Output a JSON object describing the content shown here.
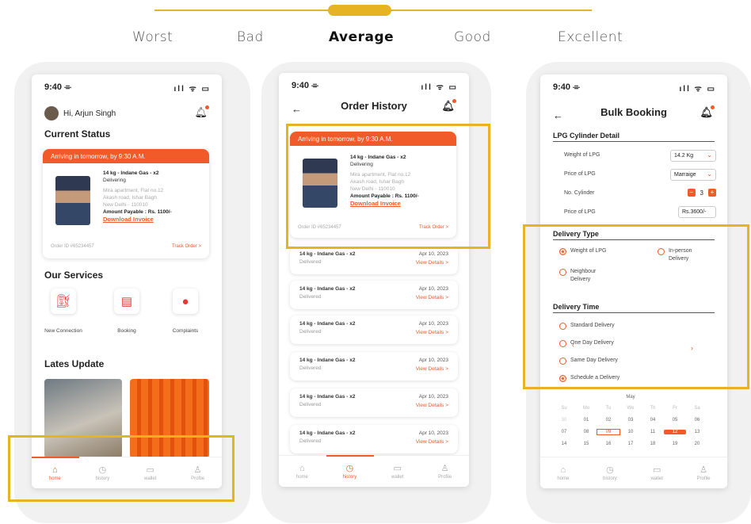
{
  "scale": {
    "labels": [
      "Worst",
      "Bad",
      "Average",
      "Good",
      "Excellent"
    ],
    "selected": "Average"
  },
  "status_bar": {
    "time": "9:40 ⌯",
    "icons": "ıll ᯤ ▭"
  },
  "phone_home": {
    "greeting": "Hi, Arjun Singh",
    "current_status": "Current Status",
    "order": {
      "banner": "Arriving in tomorrow, by 9:30 A.M.",
      "item": "14 kg - Indane Gas - x2",
      "status": "Delivering",
      "address": [
        "Mira apartment, Flat no.12",
        "Akash road, Ishar Bagh",
        "New Delhi - 110010"
      ],
      "amount": "Amount Payable : Rs. 1100/-",
      "invoice": "Download Invoice",
      "order_id": "Order ID #65234457",
      "track": "Track Order >"
    },
    "our_services": "Our Services",
    "services": [
      "New Connection",
      "Booking",
      "Complaints"
    ],
    "latest_update": "Lates Update"
  },
  "phone_history": {
    "title": "Order History",
    "items": [
      {
        "name": "14 kg - Indane Gas - x2",
        "status": "Delivered",
        "date": "Apr 10, 2023",
        "link": "View Details >"
      },
      {
        "name": "14 kg - Indane Gas - x2",
        "status": "Delivered",
        "date": "Apr 10, 2023",
        "link": "View Details >"
      },
      {
        "name": "14 kg - Indane Gas - x2",
        "status": "Delivered",
        "date": "Apr 10, 2023",
        "link": "View Details >"
      },
      {
        "name": "14 kg - Indane Gas - x2",
        "status": "Delivered",
        "date": "Apr 10, 2023",
        "link": "View Details >"
      },
      {
        "name": "14 kg - Indane Gas - x2",
        "status": "Delivered",
        "date": "Apr 10, 2023",
        "link": "View Details >"
      },
      {
        "name": "14 kg - Indane Gas - x2",
        "status": "Delivered",
        "date": "Apr 10, 2023",
        "link": "View Details >"
      }
    ]
  },
  "phone_booking": {
    "title": "Bulk Booking",
    "cylinder_section": "LPG Cylinder Detail",
    "weight_label": "Weight of LPG",
    "weight_value": "14.2 Kg",
    "price_label": "Price of LPG",
    "price_value": "Marraige",
    "count_label": "No. Cylinder",
    "count_value": "3",
    "total_label": "Price of LPG",
    "total_value": "Rs.3600/-",
    "delivery_type": "Delivery Type",
    "type_options": [
      "Weight of LPG",
      "In-person Delivery",
      "Neighbour Delivery"
    ],
    "type_selected": "Weight of LPG",
    "delivery_time": "Delivery Time",
    "time_options": [
      "Standard Delivery",
      "One Day Delivery",
      "Same Day Delivery",
      "Schedule a Delivery"
    ],
    "time_selected": "Schedule a Delivery",
    "calendar": {
      "month": "May",
      "weekdays": [
        "Su",
        "Mo",
        "Tu",
        "We",
        "Th",
        "Fr",
        "Sa"
      ],
      "rows": [
        [
          "30",
          "01",
          "02",
          "03",
          "04",
          "05",
          "06"
        ],
        [
          "07",
          "08",
          "09",
          "10",
          "11",
          "12",
          "13"
        ],
        [
          "14",
          "15",
          "16",
          "17",
          "18",
          "19",
          "20"
        ]
      ]
    }
  },
  "tabs": [
    "home",
    "history",
    "wallet",
    "Profile"
  ],
  "colors": {
    "accent": "#f15a29",
    "highlight": "#e6b422"
  }
}
